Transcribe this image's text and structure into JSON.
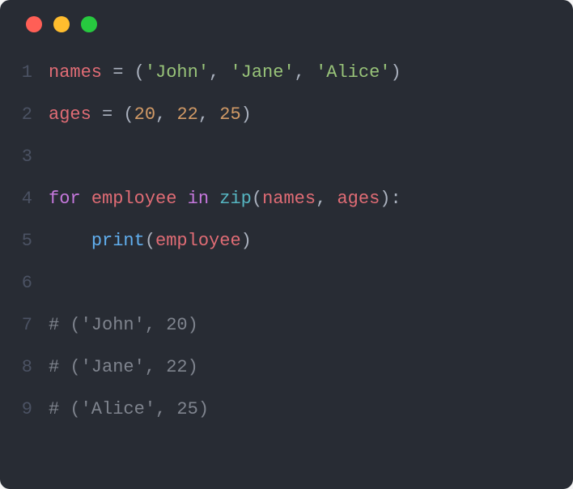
{
  "titlebar": {
    "dots": [
      "red",
      "yellow",
      "green"
    ]
  },
  "colors": {
    "background": "#282c34",
    "gutter": "#4b5263"
  },
  "lines": [
    {
      "n": "1",
      "tokens": [
        {
          "t": "names",
          "c": "var"
        },
        {
          "t": " ",
          "c": "op"
        },
        {
          "t": "=",
          "c": "op"
        },
        {
          "t": " ",
          "c": "op"
        },
        {
          "t": "(",
          "c": "punc"
        },
        {
          "t": "'John'",
          "c": "str"
        },
        {
          "t": ",",
          "c": "punc"
        },
        {
          "t": " ",
          "c": "op"
        },
        {
          "t": "'Jane'",
          "c": "str"
        },
        {
          "t": ",",
          "c": "punc"
        },
        {
          "t": " ",
          "c": "op"
        },
        {
          "t": "'Alice'",
          "c": "str"
        },
        {
          "t": ")",
          "c": "punc"
        }
      ]
    },
    {
      "n": "2",
      "tokens": [
        {
          "t": "ages",
          "c": "var"
        },
        {
          "t": " ",
          "c": "op"
        },
        {
          "t": "=",
          "c": "op"
        },
        {
          "t": " ",
          "c": "op"
        },
        {
          "t": "(",
          "c": "punc"
        },
        {
          "t": "20",
          "c": "num"
        },
        {
          "t": ",",
          "c": "punc"
        },
        {
          "t": " ",
          "c": "op"
        },
        {
          "t": "22",
          "c": "num"
        },
        {
          "t": ",",
          "c": "punc"
        },
        {
          "t": " ",
          "c": "op"
        },
        {
          "t": "25",
          "c": "num"
        },
        {
          "t": ")",
          "c": "punc"
        }
      ]
    },
    {
      "n": "3",
      "tokens": []
    },
    {
      "n": "4",
      "tokens": [
        {
          "t": "for",
          "c": "kw"
        },
        {
          "t": " ",
          "c": "op"
        },
        {
          "t": "employee",
          "c": "var"
        },
        {
          "t": " ",
          "c": "op"
        },
        {
          "t": "in",
          "c": "kw2"
        },
        {
          "t": " ",
          "c": "op"
        },
        {
          "t": "zip",
          "c": "builtin"
        },
        {
          "t": "(",
          "c": "punc"
        },
        {
          "t": "names",
          "c": "var"
        },
        {
          "t": ",",
          "c": "punc"
        },
        {
          "t": " ",
          "c": "op"
        },
        {
          "t": "ages",
          "c": "var"
        },
        {
          "t": ")",
          "c": "punc"
        },
        {
          "t": ":",
          "c": "punc"
        }
      ]
    },
    {
      "n": "5",
      "tokens": [
        {
          "t": "    ",
          "c": "op"
        },
        {
          "t": "print",
          "c": "func"
        },
        {
          "t": "(",
          "c": "punc"
        },
        {
          "t": "employee",
          "c": "var"
        },
        {
          "t": ")",
          "c": "punc"
        }
      ]
    },
    {
      "n": "6",
      "tokens": []
    },
    {
      "n": "7",
      "tokens": [
        {
          "t": "# ('John', 20)",
          "c": "comment"
        }
      ]
    },
    {
      "n": "8",
      "tokens": [
        {
          "t": "# ('Jane', 22)",
          "c": "comment"
        }
      ]
    },
    {
      "n": "9",
      "tokens": [
        {
          "t": "# ('Alice', 25)",
          "c": "comment"
        }
      ]
    }
  ]
}
